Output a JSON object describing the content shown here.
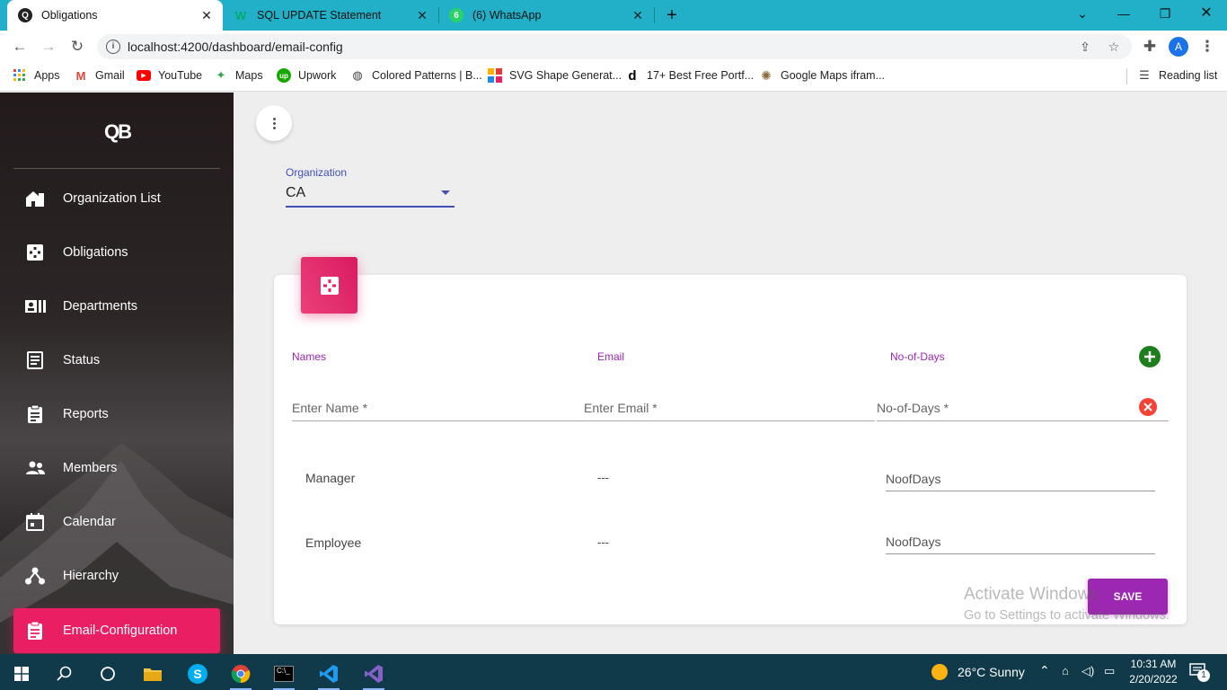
{
  "browser": {
    "tabs": [
      {
        "title": "Obligations",
        "active": true
      },
      {
        "title": "SQL UPDATE Statement",
        "active": false
      },
      {
        "title": "(6) WhatsApp",
        "active": false
      }
    ],
    "whatsapp_badge": "6",
    "url": "localhost:4200/dashboard/email-config",
    "profile_initial": "A",
    "bookmarks": [
      "Apps",
      "Gmail",
      "YouTube",
      "Maps",
      "Upwork",
      "Colored Patterns | B...",
      "SVG Shape Generat...",
      "17+ Best Free Portf...",
      "Google Maps ifram..."
    ],
    "reading_list": "Reading list"
  },
  "sidebar": {
    "logo": "QB",
    "items": [
      {
        "label": "Organization List",
        "icon": "home-icon"
      },
      {
        "label": "Obligations",
        "icon": "obligations-icon"
      },
      {
        "label": "Departments",
        "icon": "departments-icon"
      },
      {
        "label": "Status",
        "icon": "status-icon"
      },
      {
        "label": "Reports",
        "icon": "reports-icon"
      },
      {
        "label": "Members",
        "icon": "members-icon"
      },
      {
        "label": "Calendar",
        "icon": "calendar-icon"
      },
      {
        "label": "Hierarchy",
        "icon": "hierarchy-icon"
      },
      {
        "label": "Email-Configuration",
        "icon": "email-config-icon",
        "active": true
      }
    ],
    "accent": "#e91e63"
  },
  "main": {
    "organization": {
      "label": "Organization",
      "value": "CA"
    },
    "columns": {
      "names": "Names",
      "email": "Email",
      "days": "No-of-Days"
    },
    "inputs": {
      "name_placeholder": "Enter Name *",
      "email_placeholder": "Enter Email *",
      "days_placeholder": "No-of-Days *"
    },
    "rows": [
      {
        "name": "Manager",
        "email": "---",
        "days_placeholder": "NoofDays"
      },
      {
        "name": "Employee",
        "email": "---",
        "days_placeholder": "NoofDays"
      }
    ],
    "save_label": "SAVE",
    "watermark": {
      "line1": "Activate Windows",
      "line2": "Go to Settings to activate Windows."
    },
    "colors": {
      "primary": "#9c27b0",
      "indigo": "#3f51b5",
      "add": "#1e7e1e",
      "remove": "#f44336"
    }
  },
  "taskbar": {
    "weather": "26°C  Sunny",
    "time": "10:31 AM",
    "date": "2/20/2022",
    "notification_count": "1"
  }
}
